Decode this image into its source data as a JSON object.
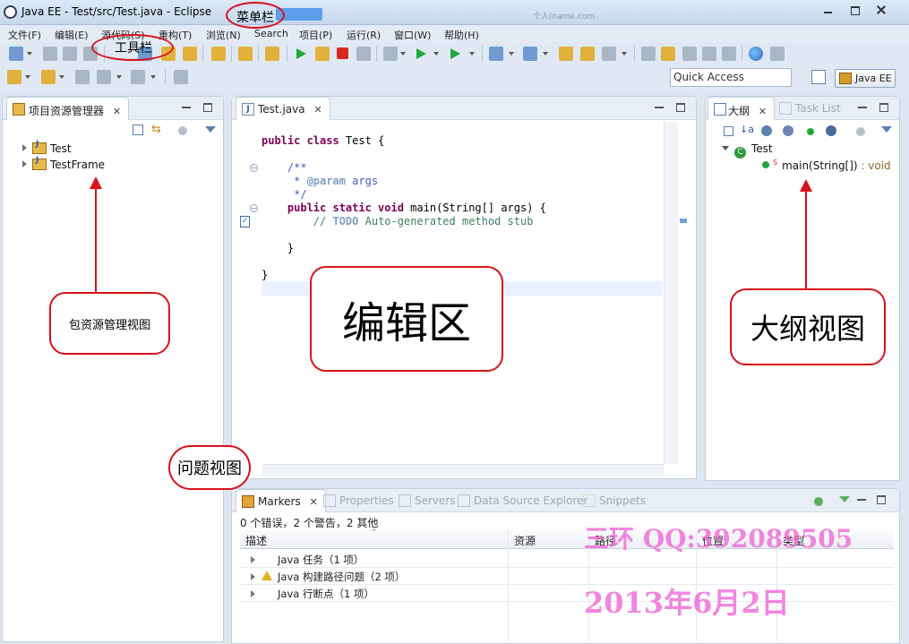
{
  "window": {
    "title": "Java EE  -  Test/src/Test.java  -  Eclipse",
    "background_hint_text": "个人(name.com"
  },
  "menu": [
    "文件(F)",
    "编辑(E)",
    "源代码(S)",
    "重构(T)",
    "浏览(N)",
    "Search",
    "项目(P)",
    "运行(R)",
    "窗口(W)",
    "帮助(H)"
  ],
  "quick_access": {
    "value": "Quick Access"
  },
  "perspective": {
    "label": "Java EE"
  },
  "package_explorer": {
    "tab_label": "项目资源管理器",
    "projects": [
      "Test",
      "TestFrame"
    ]
  },
  "editor": {
    "tab_label": "Test.java",
    "code": {
      "l1_kw": "public class",
      "l1_rest": " Test {",
      "l2": "    /**",
      "l3_star": "     * ",
      "l3_tag": "@param",
      "l3_rest": " args",
      "l4": "     */",
      "l5_kw": "    public static void",
      "l5_rest": " main(String[] args) {",
      "l6_pre": "        // ",
      "l6_todo": "TODO",
      "l6_rest": " Auto-generated method stub",
      "l7": "    }",
      "l8": "}"
    }
  },
  "outline": {
    "tab_label": "大纲",
    "tab2_label": "Task List",
    "class_name": "Test",
    "method_signature": "main(String[])",
    "method_return": " : void"
  },
  "bottom_tabs": {
    "markers": "Markers",
    "properties": "Properties",
    "servers": "Servers",
    "data_source": "Data Source Explorer",
    "snippets": "Snippets"
  },
  "markers": {
    "summary": "0 个错误，2 个警告，2 其他",
    "columns": [
      "描述",
      "资源",
      "路径",
      "位置",
      "类型"
    ],
    "rows": [
      "Java 任务（1 项）",
      "Java 构建路径问题（2 项）",
      "Java 行断点（1 项）"
    ]
  },
  "annotations": {
    "menu_bar": "菜单栏",
    "toolbar": "工具栏",
    "package_view": "包资源管理视图",
    "editor_area": "编辑区",
    "outline_view": "大纲视图",
    "problems_view": "问题视图"
  },
  "watermark": {
    "line1": "三环 QQ:392089505",
    "line2": "2013年6月2日"
  },
  "colors": {
    "annotation_red": "#d8121b",
    "watermark_pink": "#f06bd8",
    "keyword": "#7f0055",
    "comment": "#3f7f5f",
    "javadoc": "#3f5fbf"
  }
}
